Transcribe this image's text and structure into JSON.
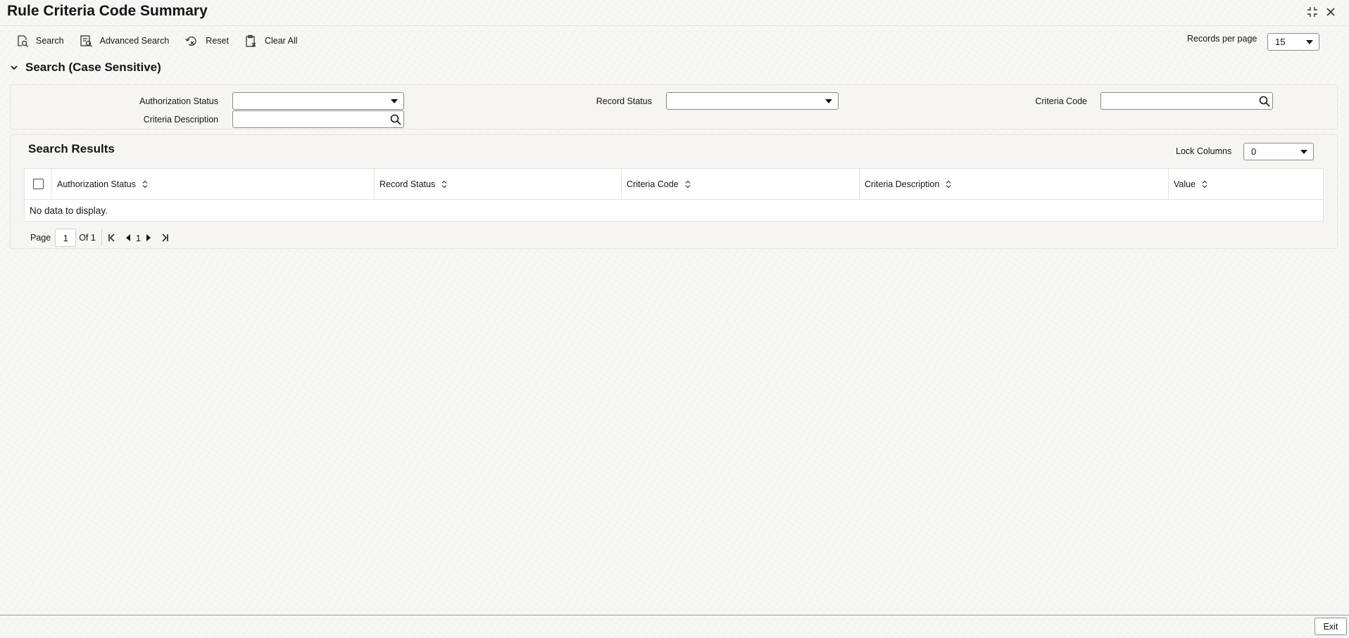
{
  "window": {
    "title": "Rule Criteria Code Summary",
    "controls": [
      "shrink-icon",
      "close-icon"
    ]
  },
  "toolbar": {
    "search_label": "Search",
    "advanced_search_label": "Advanced Search",
    "reset_label": "Reset",
    "clear_all_label": "Clear All",
    "records_per_page_label": "Records per page",
    "records_per_page_value": "15"
  },
  "search_section": {
    "title": "Search (Case Sensitive)",
    "fields": {
      "authorization_status": {
        "label": "Authorization Status",
        "value": ""
      },
      "record_status": {
        "label": "Record Status",
        "value": ""
      },
      "criteria_code": {
        "label": "Criteria Code",
        "value": ""
      },
      "criteria_description": {
        "label": "Criteria Description",
        "value": ""
      }
    }
  },
  "results": {
    "title": "Search Results",
    "lock_columns_label": "Lock Columns",
    "lock_columns_value": "0",
    "columns": [
      "Authorization Status",
      "Record Status",
      "Criteria Code",
      "Criteria Description",
      "Value"
    ],
    "rows": [],
    "empty_message": "No data to display."
  },
  "pagination": {
    "page_label": "Page",
    "current_page": "1",
    "of_label": "Of 1",
    "page_link": "1"
  },
  "footer": {
    "exit_label": "Exit"
  }
}
